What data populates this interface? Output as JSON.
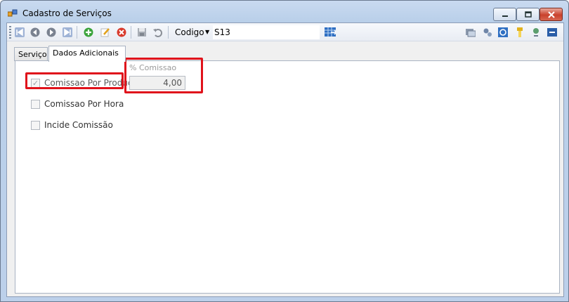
{
  "window": {
    "title": "Cadastro de Serviços"
  },
  "toolbar": {
    "codigo_label": "Codigo",
    "codigo_value": "S13",
    "left_icons": [
      "first-record-icon",
      "previous-record-icon",
      "next-record-icon",
      "last-record-icon",
      "add-icon",
      "edit-icon",
      "delete-icon",
      "save-icon",
      "undo-icon"
    ],
    "right_icons": [
      "report-icon",
      "settings-icon",
      "refresh-icon",
      "filter-icon",
      "map-pin-icon",
      "exit-icon"
    ]
  },
  "tabs": [
    {
      "label": "Serviço",
      "active": false
    },
    {
      "label": "Dados Adicionais",
      "active": true
    }
  ],
  "panel": {
    "checkboxes": [
      {
        "label": "Comissao Por Produção",
        "checked": true,
        "enabled": false
      },
      {
        "label": "Comissao Por Hora",
        "checked": false,
        "enabled": true
      },
      {
        "label": "Incide Comissão",
        "checked": false,
        "enabled": true
      }
    ],
    "comissao": {
      "label": "% Comissao",
      "value": "4,00"
    }
  },
  "colors": {
    "highlight": "#e0121b",
    "title_bar": "#c9daf0"
  }
}
